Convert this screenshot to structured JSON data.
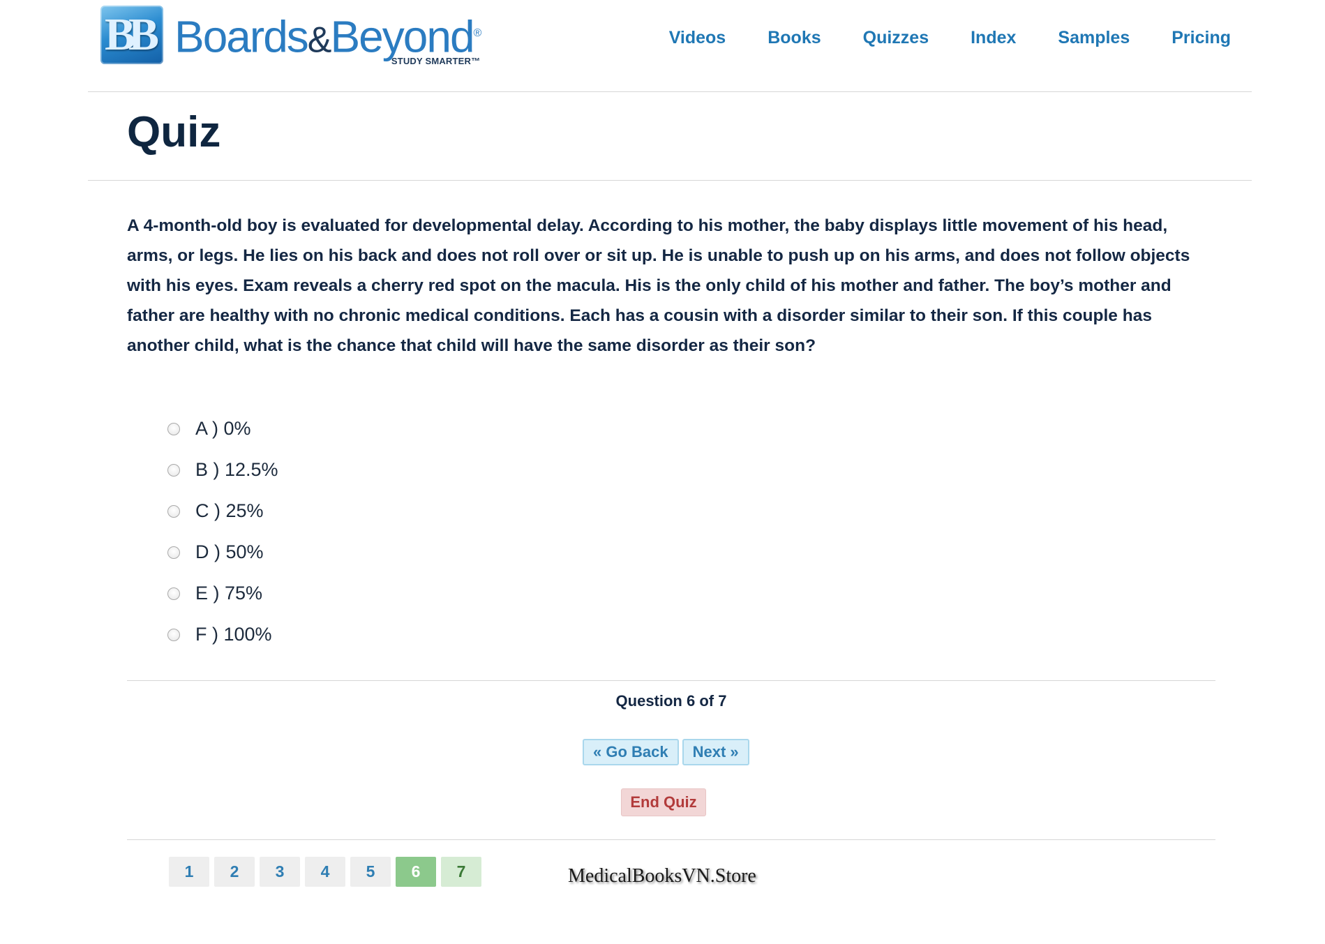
{
  "header": {
    "logo_mark": "BB",
    "brand_part1": "Boards",
    "brand_amp": "&",
    "brand_part2": "Beyond",
    "brand_registered": "®",
    "tagline": "STUDY SMARTER™",
    "nav": [
      {
        "label": "Videos"
      },
      {
        "label": "Books"
      },
      {
        "label": "Quizzes"
      },
      {
        "label": "Index"
      },
      {
        "label": "Samples"
      },
      {
        "label": "Pricing"
      }
    ]
  },
  "page": {
    "title": "Quiz"
  },
  "question": {
    "text": "A 4-month-old boy is evaluated for developmental delay. According to his mother, the baby displays little movement of his head, arms, or legs. He lies on his back and does not roll over or sit up. He is unable to push up on his arms, and does not follow objects with his eyes. Exam reveals a cherry red spot on the macula. His is the only child of his mother and father. The boy’s mother and father are healthy with no chronic medical conditions. Each has a cousin with a disorder similar to their son. If this couple has another child, what is the chance that child will have the same disorder as their son?",
    "choices": [
      {
        "label": "A ) 0%"
      },
      {
        "label": "B ) 12.5%"
      },
      {
        "label": "C ) 25%"
      },
      {
        "label": "D ) 50%"
      },
      {
        "label": "E ) 75%"
      },
      {
        "label": "F ) 100%"
      }
    ]
  },
  "footer": {
    "progress": "Question 6 of 7",
    "go_back_label": "« Go Back",
    "next_label": "Next »",
    "end_quiz_label": "End Quiz",
    "pages": [
      {
        "label": "1",
        "state": "answered"
      },
      {
        "label": "2",
        "state": "answered"
      },
      {
        "label": "3",
        "state": "answered"
      },
      {
        "label": "4",
        "state": "answered"
      },
      {
        "label": "5",
        "state": "answered"
      },
      {
        "label": "6",
        "state": "current"
      },
      {
        "label": "7",
        "state": "unanswered"
      }
    ],
    "watermark": "MedicalBooksVN.Store"
  },
  "colors": {
    "nav_link": "#1f77b4",
    "title": "#0f2640",
    "current_page": "#8cc98c",
    "end_quiz": "#b23b3b"
  }
}
